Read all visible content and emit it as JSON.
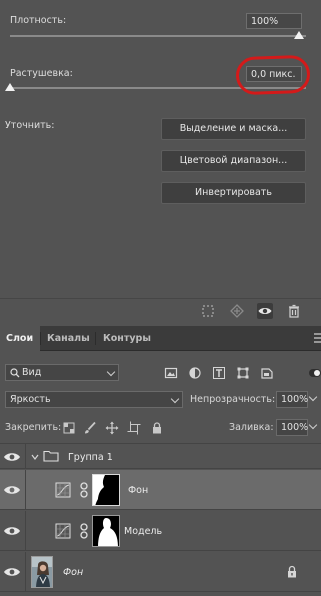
{
  "properties": {
    "density_label": "Плотность:",
    "density_value": "100%",
    "feather_label": "Растушевка:",
    "feather_value": "0,0 пикс.",
    "refine_label": "Уточнить:",
    "buttons": [
      "Выделение и маска...",
      "Цветовой диапазон...",
      "Инвертировать"
    ],
    "annotation_color": "#d41a1a"
  },
  "layers_panel": {
    "tabs": [
      "Слои",
      "Каналы",
      "Контуры"
    ],
    "active_tab": "Слои",
    "kind_filter": "Вид",
    "blend_mode": "Яркость",
    "opacity_label": "Непрозрачность:",
    "opacity_value": "100%",
    "lock_label": "Закрепить:",
    "fill_label": "Заливка:",
    "fill_value": "100%",
    "layers": [
      {
        "name": "Группа 1",
        "type": "group",
        "visible": true,
        "expanded": true
      },
      {
        "name": "Фон",
        "type": "adjustment-with-mask",
        "visible": true,
        "selected": true,
        "indented": true
      },
      {
        "name": "Модель",
        "type": "adjustment-with-mask",
        "visible": true,
        "selected": false,
        "indented": true
      },
      {
        "name": "Фон",
        "type": "background-image",
        "visible": true,
        "locked": true
      }
    ]
  }
}
